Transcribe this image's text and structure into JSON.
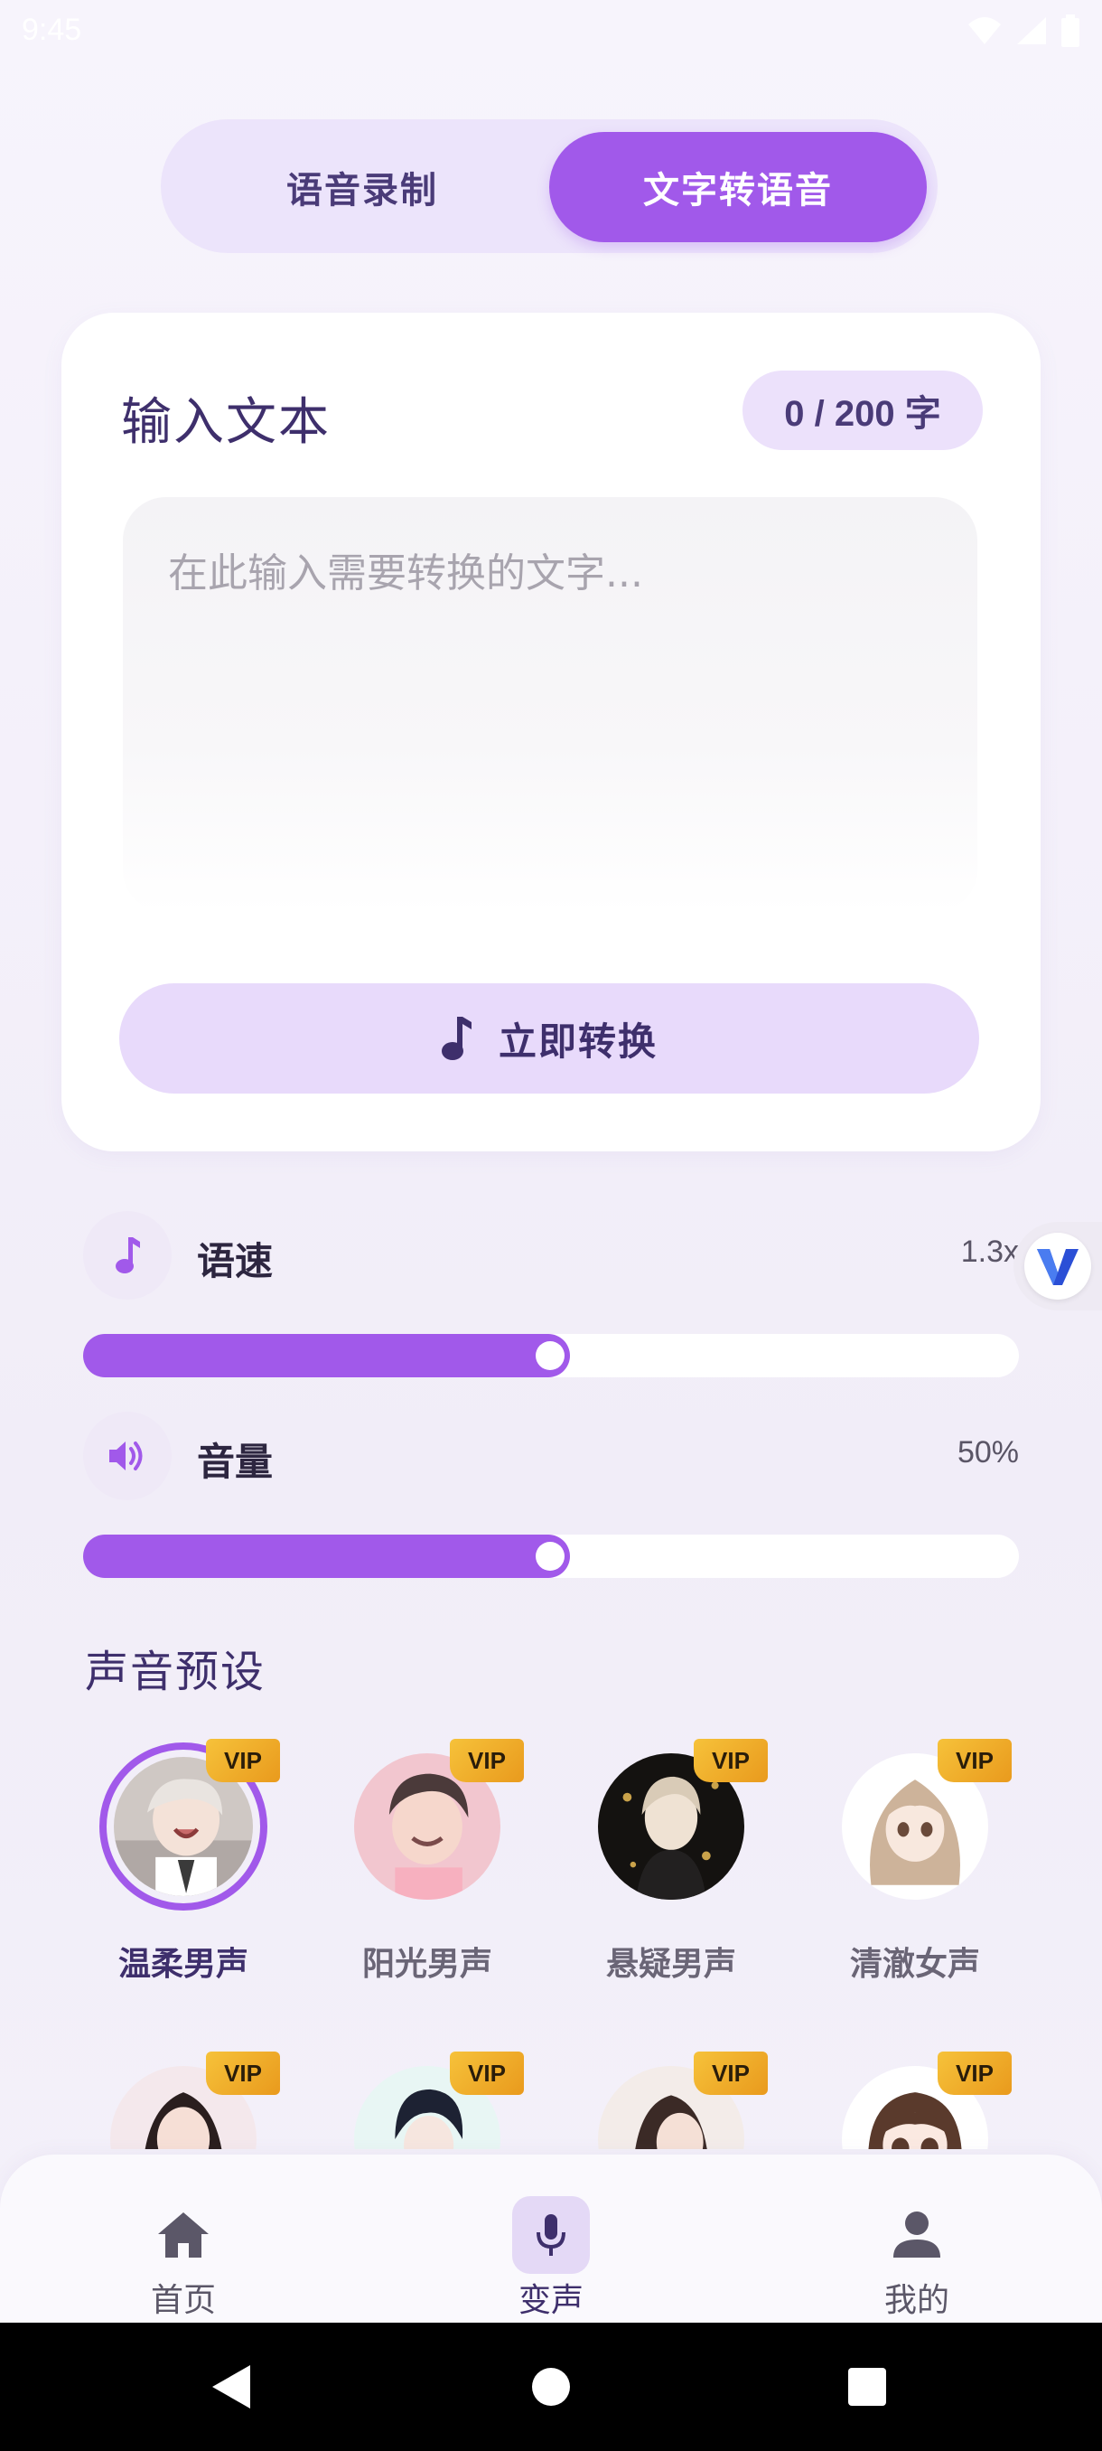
{
  "status_bar": {
    "time": "9:45"
  },
  "mode_switch": {
    "tabs": [
      {
        "label": "语音录制",
        "active": false
      },
      {
        "label": "文字转语音",
        "active": true
      }
    ]
  },
  "text_card": {
    "title": "输入文本",
    "char_count": "0 / 200 字",
    "input_value": "",
    "input_placeholder": "在此输入需要转换的文字...",
    "convert_label": "立即转换",
    "convert_icon": "music-note-icon"
  },
  "speed": {
    "label": "语速",
    "value_text": "1.3x",
    "level": 0.5,
    "icon": "music-note-icon"
  },
  "volume": {
    "label": "音量",
    "value_text": "50%",
    "level": 0.5,
    "icon": "speaker-icon"
  },
  "presets": {
    "title": "声音预设",
    "badge": "VIP",
    "items": [
      {
        "name": "温柔男声",
        "selected": true
      },
      {
        "name": "阳光男声",
        "selected": false
      },
      {
        "name": "悬疑男声",
        "selected": false
      },
      {
        "name": "清澈女声",
        "selected": false
      },
      {
        "name": "",
        "selected": false
      },
      {
        "name": "",
        "selected": false
      },
      {
        "name": "",
        "selected": false
      },
      {
        "name": "",
        "selected": false
      }
    ]
  },
  "bottom_nav": {
    "items": [
      {
        "label": "首页",
        "icon": "home-icon",
        "active": false
      },
      {
        "label": "变声",
        "icon": "microphone-icon",
        "active": true
      },
      {
        "label": "我的",
        "icon": "user-icon",
        "active": false
      }
    ]
  },
  "colors": {
    "accent": "#a159ea",
    "accent_light": "#e8dafb",
    "title_text": "#3e2f6c",
    "vip_gold": "#f2b22c"
  }
}
